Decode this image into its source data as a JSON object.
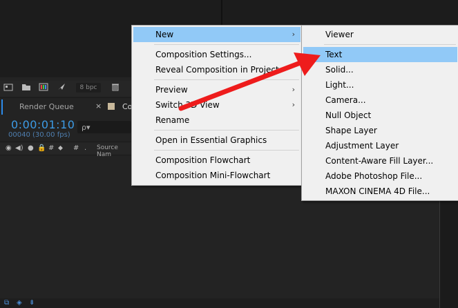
{
  "toolbar": {
    "bpc_label": "8 bpc"
  },
  "tabs": {
    "render_queue": "Render Queue",
    "close_glyph": "×",
    "comp_tab_partial": "Co"
  },
  "timeline": {
    "timecode": "0:00:01:10",
    "frame_fps": "00040 (30.00 fps)",
    "search_glyph": "ρ▾",
    "source_name_header": "Source Nam"
  },
  "column_icons": [
    "◉",
    "◀)",
    "●",
    "🔒",
    "#",
    "⬥",
    "#",
    "."
  ],
  "menu": {
    "items": [
      {
        "label": "New",
        "submenu": true,
        "highlighted": true
      },
      {
        "label": "Composition Settings...",
        "submenu": false
      },
      {
        "label": "Reveal Composition in Project",
        "submenu": false
      },
      {
        "label": "Preview",
        "submenu": true
      },
      {
        "label": "Switch 3D View",
        "submenu": true
      },
      {
        "label": "Rename",
        "submenu": false
      },
      {
        "label": "Open in Essential Graphics",
        "submenu": false
      },
      {
        "label": "Composition Flowchart",
        "submenu": false
      },
      {
        "label": "Composition Mini-Flowchart",
        "submenu": false
      }
    ],
    "arrow_glyph": "›"
  },
  "submenu": {
    "items": [
      {
        "label": "Viewer"
      },
      {
        "label": "Text",
        "highlighted": true
      },
      {
        "label": "Solid..."
      },
      {
        "label": "Light..."
      },
      {
        "label": "Camera..."
      },
      {
        "label": "Null Object"
      },
      {
        "label": "Shape Layer"
      },
      {
        "label": "Adjustment Layer"
      },
      {
        "label": "Content-Aware Fill Layer..."
      },
      {
        "label": "Adobe Photoshop File..."
      },
      {
        "label": "MAXON CINEMA 4D File..."
      }
    ]
  },
  "colors": {
    "highlight": "#91c9f7",
    "timecode": "#3c9be6",
    "annotation_arrow": "#ee1c1c",
    "menu_bg": "#f0f0f0"
  }
}
